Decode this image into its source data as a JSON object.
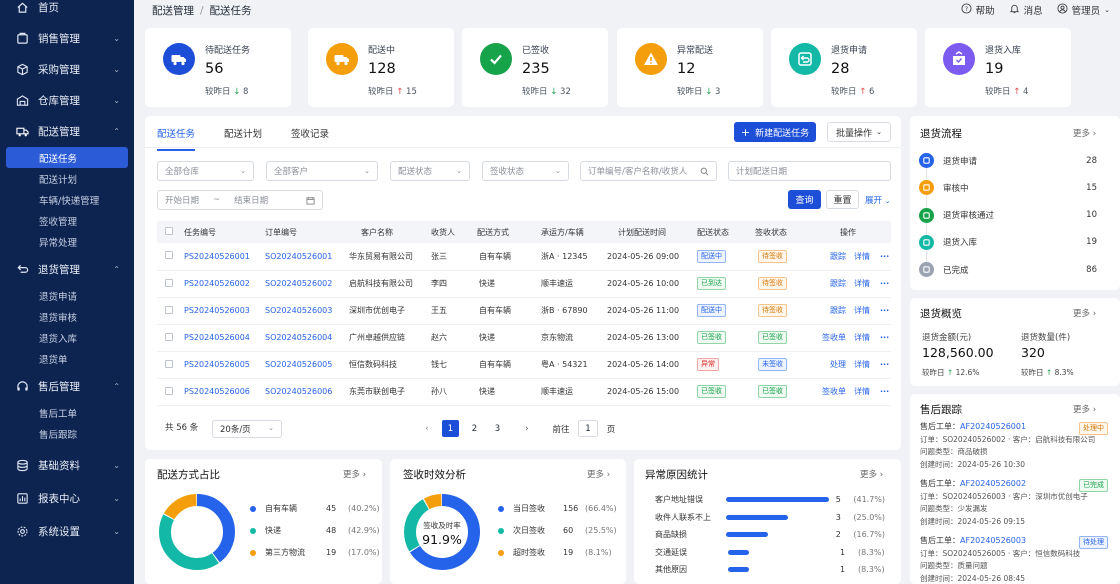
{
  "sidebar": {
    "items": [
      {
        "label": "首页",
        "icon": "home-icon"
      },
      {
        "label": "销售管理",
        "icon": "sales-icon"
      },
      {
        "label": "采购管理",
        "icon": "cube-icon"
      },
      {
        "label": "仓库管理",
        "icon": "warehouse-icon"
      },
      {
        "label": "配送管理",
        "icon": "truck-icon",
        "children": [
          "配送任务",
          "配送计划",
          "车辆/快递管理",
          "签收管理",
          "异常处理"
        ]
      },
      {
        "label": "退货管理",
        "icon": "return-icon",
        "children": [
          "退货申请",
          "退货审核",
          "退货入库",
          "退货单"
        ]
      },
      {
        "label": "售后管理",
        "icon": "service-icon",
        "children": [
          "售后工单",
          "售后跟踪"
        ]
      },
      {
        "label": "基础资料",
        "icon": "database-icon"
      },
      {
        "label": "报表中心",
        "icon": "report-icon"
      },
      {
        "label": "系统设置",
        "icon": "gear-icon"
      }
    ]
  },
  "header": {
    "breadcrumb": [
      "配送管理",
      "配送任务"
    ],
    "help": "帮助",
    "messages": "消息",
    "user": "管理员"
  },
  "stats": [
    {
      "label": "待配送任务",
      "value": "56",
      "compare": "较昨日",
      "delta": "8",
      "dir": "down",
      "color": "#1d4ed8",
      "icon": "truck-icon"
    },
    {
      "label": "配送中",
      "value": "128",
      "compare": "较昨日",
      "delta": "15",
      "dir": "up",
      "color": "#f59e0b",
      "icon": "truck-icon"
    },
    {
      "label": "已签收",
      "value": "235",
      "compare": "较昨日",
      "delta": "32",
      "dir": "down",
      "color": "#16a34a",
      "icon": "check-icon"
    },
    {
      "label": "异常配送",
      "value": "12",
      "compare": "较昨日",
      "delta": "3",
      "dir": "down",
      "color": "#f59e0b",
      "icon": "warning-icon"
    },
    {
      "label": "退货申请",
      "value": "28",
      "compare": "较昨日",
      "delta": "6",
      "dir": "up",
      "color": "#14b8a6",
      "icon": "return-icon"
    },
    {
      "label": "退货入库",
      "value": "19",
      "compare": "较昨日",
      "delta": "4",
      "dir": "up",
      "color": "#7c5cf0",
      "icon": "inbox-icon"
    }
  ],
  "tabs": [
    "配送任务",
    "配送计划",
    "签收记录"
  ],
  "actions": {
    "new": "新建配送任务",
    "batch": "批量操作"
  },
  "filters": {
    "warehouse": "全部仓库",
    "customer": "全部客户",
    "delivery_status": "配送状态",
    "sign_status": "签收状态",
    "search_placeholder": "订单编号/客户名称/收货人",
    "date_placeholder": "计划配送日期",
    "start": "开始日期",
    "tilde": "~",
    "end": "结束日期",
    "query": "查询",
    "reset": "重置",
    "expand": "展开"
  },
  "table": {
    "columns": [
      "任务编号",
      "订单编号",
      "客户名称",
      "收货人",
      "配送方式",
      "承运方/车辆",
      "计划配送时间",
      "配送状态",
      "签收状态",
      "操作"
    ],
    "rows": [
      {
        "task": "PS20240526001",
        "order": "SO20240526001",
        "customer": "华东贸易有限公司",
        "receiver": "张三",
        "method": "自有车辆",
        "carrier": "浙A · 12345",
        "time": "2024-05-26 09:00",
        "status": "配送中",
        "sclass": "b-blue",
        "sign": "待签收",
        "gclass": "b-orange",
        "op1": "跟踪",
        "op2": "详情"
      },
      {
        "task": "PS20240526002",
        "order": "SO20240526002",
        "customer": "启航科技有限公司",
        "receiver": "李四",
        "method": "快递",
        "carrier": "顺丰速运",
        "time": "2024-05-26 10:00",
        "status": "已到达",
        "sclass": "b-green",
        "sign": "待签收",
        "gclass": "b-orange",
        "op1": "跟踪",
        "op2": "详情"
      },
      {
        "task": "PS20240526003",
        "order": "SO20240526003",
        "customer": "深圳市优创电子",
        "receiver": "王五",
        "method": "自有车辆",
        "carrier": "浙B · 67890",
        "time": "2024-05-26 11:00",
        "status": "配送中",
        "sclass": "b-blue",
        "sign": "待签收",
        "gclass": "b-orange",
        "op1": "跟踪",
        "op2": "详情"
      },
      {
        "task": "PS20240526004",
        "order": "SO20240526004",
        "customer": "广州卓越供应链",
        "receiver": "赵六",
        "method": "快递",
        "carrier": "京东物流",
        "time": "2024-05-26 13:00",
        "status": "已签收",
        "sclass": "b-green",
        "sign": "已签收",
        "gclass": "b-green",
        "op1": "签收单",
        "op2": "详情"
      },
      {
        "task": "PS20240526005",
        "order": "SO20240526005",
        "customer": "恒信数码科技",
        "receiver": "钱七",
        "method": "自有车辆",
        "carrier": "粤A · 54321",
        "time": "2024-05-26 14:00",
        "status": "异常",
        "sclass": "b-red",
        "sign": "未签收",
        "gclass": "b-blue",
        "op1": "处理",
        "op2": "详情"
      },
      {
        "task": "PS20240526006",
        "order": "SO20240526006",
        "customer": "东莞市联创电子",
        "receiver": "孙八",
        "method": "快递",
        "carrier": "顺丰速运",
        "time": "2024-05-26 15:00",
        "status": "已签收",
        "sclass": "b-green",
        "sign": "已签收",
        "gclass": "b-green",
        "op1": "签收单",
        "op2": "详情"
      }
    ],
    "ops_label": "操作"
  },
  "pagination": {
    "total": "共 56 条",
    "size": "20条/页",
    "pages": [
      "1",
      "2",
      "3"
    ],
    "goto": "前往",
    "goto_val": "1",
    "page_unit": "页"
  },
  "panels": {
    "more": "更多",
    "method_title": "配送方式占比",
    "sign_title": "签收时效分析",
    "exception_title": "异常原因统计",
    "sign_center_label": "签收及时率",
    "sign_center_value": "91.9%"
  },
  "chart_data": [
    {
      "type": "pie",
      "title": "配送方式占比",
      "series": [
        {
          "name": "自有车辆",
          "value": 45,
          "pct": "(40.2%)",
          "color": "#2563eb"
        },
        {
          "name": "快递",
          "value": 48,
          "pct": "(42.9%)",
          "color": "#14b8a6"
        },
        {
          "name": "第三方物流",
          "value": 19,
          "pct": "(17.0%)",
          "color": "#f59e0b"
        }
      ]
    },
    {
      "type": "pie",
      "title": "签收时效分析",
      "series": [
        {
          "name": "当日签收",
          "value": 156,
          "pct": "(66.4%)",
          "color": "#2563eb"
        },
        {
          "name": "次日签收",
          "value": 60,
          "pct": "(25.5%)",
          "color": "#14b8a6"
        },
        {
          "name": "超时签收",
          "value": 19,
          "pct": "(8.1%)",
          "color": "#f59e0b"
        }
      ]
    },
    {
      "type": "bar",
      "title": "异常原因统计",
      "categories": [
        "客户地址错误",
        "收件人联系不上",
        "商品缺损",
        "交通延误",
        "其他原因"
      ],
      "values": [
        5,
        3,
        2,
        1,
        1
      ],
      "pct": [
        "(41.7%)",
        "(25.0%)",
        "(16.7%)",
        "(8.3%)",
        "(8.3%)"
      ]
    }
  ],
  "return_flow": {
    "title": "退货流程",
    "steps": [
      {
        "label": "退货申请",
        "count": "28",
        "color": "#2563eb"
      },
      {
        "label": "审核中",
        "count": "15",
        "color": "#f59e0b"
      },
      {
        "label": "退货审核通过",
        "count": "10",
        "color": "#16a34a"
      },
      {
        "label": "退货入库",
        "count": "19",
        "color": "#14b8a6"
      },
      {
        "label": "已完成",
        "count": "86",
        "color": "#9aa3b2"
      }
    ]
  },
  "return_overview": {
    "title": "退货概览",
    "amount_label": "退货金额(元)",
    "amount": "128,560.00",
    "amount_cmp": "较昨日",
    "amount_delta": "12.6%",
    "qty_label": "退货数量(件)",
    "qty": "320",
    "qty_cmp": "较昨日",
    "qty_delta": "8.3%"
  },
  "after_sales": {
    "title": "售后跟踪",
    "items": [
      {
        "ticket_label": "售后工单：",
        "ticket": "AF20240526001",
        "status": "处理中",
        "sclass": "b-orange",
        "line1": "订单：SO20240526002 · 客户：启航科技有限公司",
        "line2": "问题类型：商品破损",
        "line3": "创建时间：2024-05-26  10:30"
      },
      {
        "ticket_label": "售后工单：",
        "ticket": "AF20240526002",
        "status": "已完成",
        "sclass": "b-green",
        "line1": "订单：SO20240526003 · 客户：深圳市优创电子",
        "line2": "问题类型：少发漏发",
        "line3": "创建时间：2024-05-26  09:15"
      },
      {
        "ticket_label": "售后工单：",
        "ticket": "AF20240526003",
        "status": "待处理",
        "sclass": "b-blue",
        "line1": "订单：SO20240526005 · 客户：恒信数码科技",
        "line2": "问题类型：质量问题",
        "line3": "创建时间：2024-05-26  08:45"
      }
    ]
  }
}
